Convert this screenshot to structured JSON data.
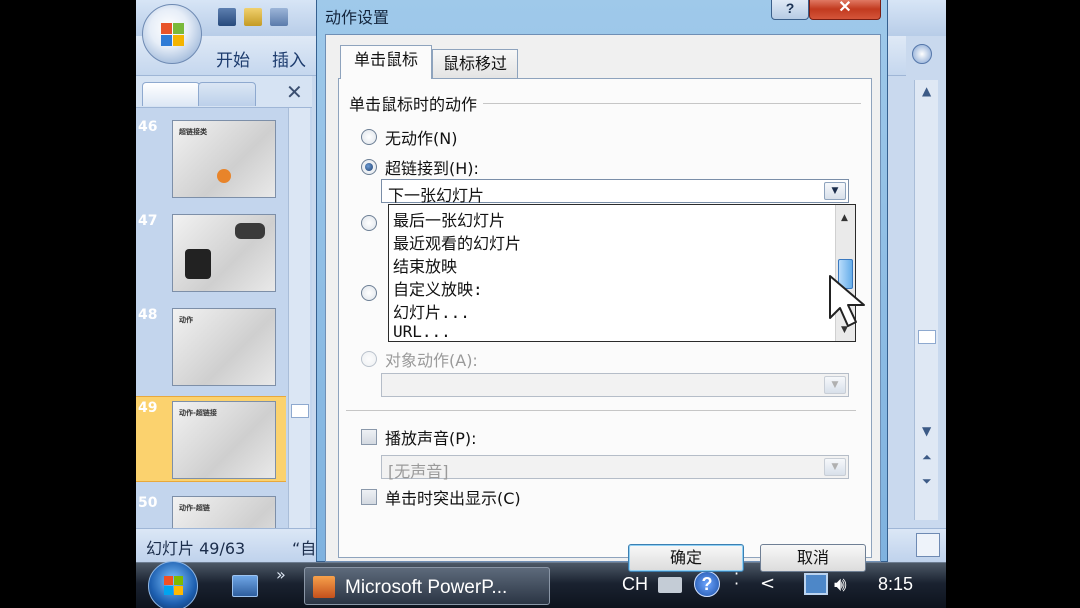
{
  "ppt": {
    "ribbon_tabs": [
      "开始",
      "插入"
    ],
    "slides": [
      {
        "number": "46",
        "title": "超链接类"
      },
      {
        "number": "47",
        "title": ""
      },
      {
        "number": "48",
        "title": "动作"
      },
      {
        "number": "49",
        "title": "动作-超链接"
      },
      {
        "number": "50",
        "title": "动作-超链"
      }
    ],
    "status_slide": "幻灯片 49/63",
    "status_theme": "“自"
  },
  "dialog": {
    "title": "动作设置",
    "help_glyph": "?",
    "close_glyph": "✕",
    "tabs": [
      "单击鼠标",
      "鼠标移过"
    ],
    "group_label": "单击鼠标时的动作",
    "opt_none": "无动作(N)",
    "opt_hyperlink": "超链接到(H):",
    "hyperlink_value": "下一张幻灯片",
    "dropdown_items": [
      "最后一张幻灯片",
      "最近观看的幻灯片",
      "结束放映",
      "自定义放映:",
      "幻灯片...",
      "URL..."
    ],
    "opt_object": "对象动作(A):",
    "play_sound": "播放声音(P):",
    "sound_value": "[无声音]",
    "highlight": "单击时突出显示(C)",
    "ok": "确定",
    "cancel": "取消"
  },
  "taskbar": {
    "app_label": "Microsoft PowerP...",
    "lang": "CH",
    "help": "?",
    "clock": "8:15"
  },
  "overlay_close": "✕"
}
